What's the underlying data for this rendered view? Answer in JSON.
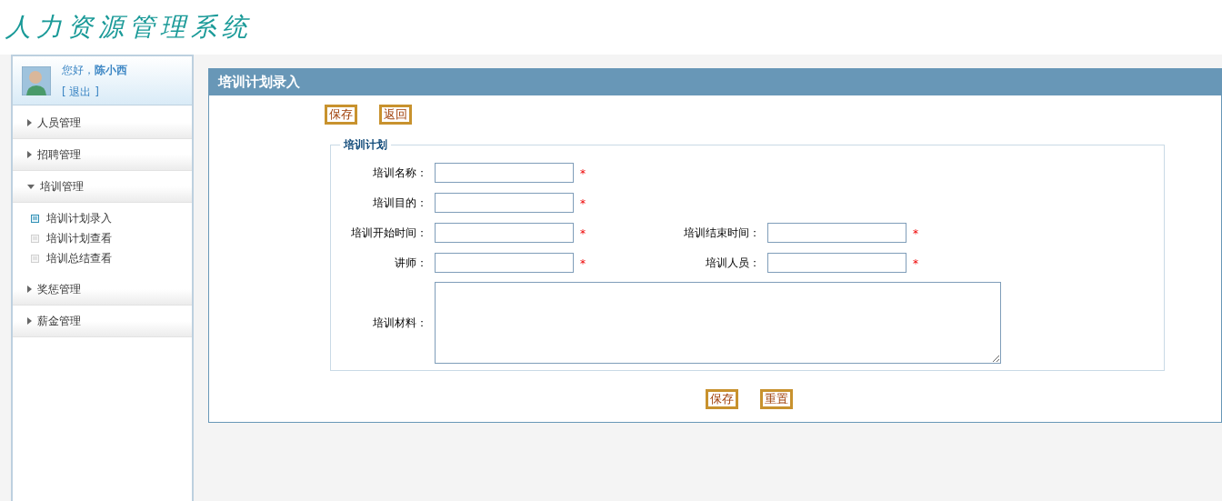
{
  "logo": {
    "title": "人力资源管理系统"
  },
  "user": {
    "greeting": "您好，**陈小西**",
    "logout": "[ 退出 ]"
  },
  "sidebar": {
    "items": [
      {
        "label": "人员管理",
        "expanded": false
      },
      {
        "label": "招聘管理",
        "expanded": false
      },
      {
        "label": "培训管理",
        "expanded": true,
        "children": [
          {
            "label": "培训计划录入",
            "selected": true
          },
          {
            "label": "培训计划查看",
            "selected": false
          },
          {
            "label": "培训总结查看",
            "selected": false
          }
        ]
      },
      {
        "label": "奖惩管理",
        "expanded": false
      },
      {
        "label": "薪金管理",
        "expanded": false
      }
    ]
  },
  "panel": {
    "title": "培训计划录入",
    "top_buttons": [
      "保存",
      "返回"
    ],
    "fieldset": {
      "legend": "培训计划",
      "rows": [
        [
          {
            "kind": "input",
            "label": "培训名称：",
            "required": true
          }
        ],
        [
          {
            "kind": "input",
            "label": "培训目的：",
            "required": true
          }
        ],
        [
          {
            "kind": "input",
            "label": "培训开始时间：",
            "required": true
          },
          {
            "kind": "input",
            "label": "培训结束时间：",
            "required": true
          }
        ],
        [
          {
            "kind": "input",
            "label": "讲师：",
            "required": true
          },
          {
            "kind": "input",
            "label": "培训人员：",
            "required": true
          }
        ],
        [
          {
            "kind": "textarea",
            "label": "培训材料：",
            "required": false
          }
        ]
      ]
    },
    "bottom_buttons": [
      "保存",
      "重置"
    ]
  },
  "required_mark": "*"
}
